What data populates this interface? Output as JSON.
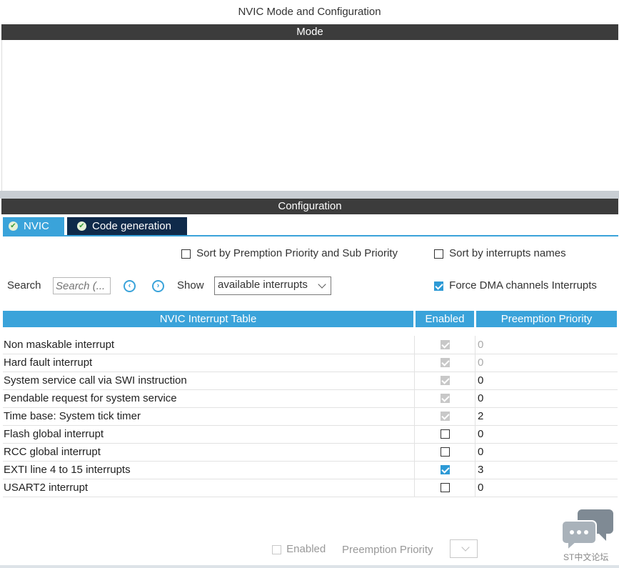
{
  "window": {
    "title": "NVIC Mode and Configuration"
  },
  "sections": {
    "mode": "Mode",
    "configuration": "Configuration"
  },
  "tabs": [
    {
      "label": "NVIC",
      "active": true
    },
    {
      "label": "Code generation",
      "active": false
    }
  ],
  "options": {
    "sort_priority": {
      "label": "Sort by Premption Priority and Sub Priority",
      "checked": false
    },
    "sort_names": {
      "label": "Sort by interrupts names",
      "checked": false
    },
    "force_dma": {
      "label": "Force DMA channels Interrupts",
      "checked": true
    }
  },
  "search": {
    "label": "Search",
    "placeholder": "Search (..."
  },
  "show": {
    "label": "Show",
    "selected": "available interrupts"
  },
  "table": {
    "headers": [
      "NVIC Interrupt Table",
      "Enabled",
      "Preemption Priority"
    ],
    "rows": [
      {
        "name": "Non maskable interrupt",
        "enabled": true,
        "locked": true,
        "priority": "0",
        "priority_dim": true
      },
      {
        "name": "Hard fault interrupt",
        "enabled": true,
        "locked": true,
        "priority": "0",
        "priority_dim": true
      },
      {
        "name": "System service call via SWI instruction",
        "enabled": true,
        "locked": true,
        "priority": "0",
        "priority_dim": false
      },
      {
        "name": "Pendable request for system service",
        "enabled": true,
        "locked": true,
        "priority": "0",
        "priority_dim": false
      },
      {
        "name": "Time base: System tick timer",
        "enabled": true,
        "locked": true,
        "priority": "2",
        "priority_dim": false
      },
      {
        "name": "Flash global interrupt",
        "enabled": false,
        "locked": false,
        "priority": "0",
        "priority_dim": false
      },
      {
        "name": "RCC global interrupt",
        "enabled": false,
        "locked": false,
        "priority": "0",
        "priority_dim": false
      },
      {
        "name": "EXTI line 4 to 15 interrupts",
        "enabled": true,
        "locked": false,
        "priority": "3",
        "priority_dim": false
      },
      {
        "name": "USART2 interrupt",
        "enabled": false,
        "locked": false,
        "priority": "0",
        "priority_dim": false
      }
    ]
  },
  "bottom": {
    "enabled_label": "Enabled",
    "priority_label": "Preemption Priority"
  },
  "watermark": {
    "text": "ST中文论坛"
  },
  "icons": {
    "tab_check": "check-circle-icon",
    "prev": "chevron-left-circle-icon",
    "next": "chevron-right-circle-icon",
    "dropdown": "chevron-down-icon",
    "chat": "chat-bubbles-icon"
  },
  "colors": {
    "accent": "#3aa3da",
    "section_bar": "#3c3c3c",
    "active_tab_dark": "#0f2a4a",
    "checkbox_checked": "#2d9ad6"
  }
}
